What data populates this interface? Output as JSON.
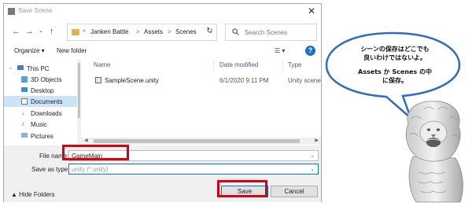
{
  "dialog": {
    "title": "Save Scene",
    "close_label": "✕"
  },
  "address": {
    "chevrons": "«",
    "crumbs": [
      "Janken Battle",
      "Assets",
      "Scenes"
    ],
    "separator": ">"
  },
  "search": {
    "placeholder": "Search Scenes"
  },
  "commandbar": {
    "organize_label": "Organize ▾",
    "new_folder_label": "New folder"
  },
  "nav_pane": {
    "items": [
      {
        "label": "This PC",
        "icon": "pc-icon"
      },
      {
        "label": "3D Objects",
        "icon": "cube-icon"
      },
      {
        "label": "Desktop",
        "icon": "desktop-icon"
      },
      {
        "label": "Documents",
        "icon": "document-icon",
        "selected": true
      },
      {
        "label": "Downloads",
        "icon": "download-icon"
      },
      {
        "label": "Music",
        "icon": "music-icon"
      },
      {
        "label": "Pictures",
        "icon": "picture-icon"
      }
    ]
  },
  "file_list": {
    "columns": [
      "Name",
      "Date modified",
      "Type"
    ],
    "rows": [
      {
        "name": "SampleScene.unity",
        "date": "6/1/2020 9:11 PM",
        "type": "Unity scene fi"
      }
    ]
  },
  "form": {
    "file_name_label": "File name:",
    "file_name_value": "GameMain",
    "save_as_type_label": "Save as type:",
    "save_as_type_value": "unity (*.unity)",
    "hide_folders_label": "Hide Folders",
    "save_label": "Save",
    "cancel_label": "Cancel"
  },
  "speech_bubble": {
    "line1": "シーンの保存はどこでも",
    "line2": "良いわけではないよ。",
    "line3": "Assets か Scenes の中",
    "line4": "に保存。"
  },
  "colors": {
    "highlight": "#d90014",
    "accent": "#0078d7",
    "selected_bg": "#cce4f7",
    "bubble_border": "#2d6cc0"
  }
}
